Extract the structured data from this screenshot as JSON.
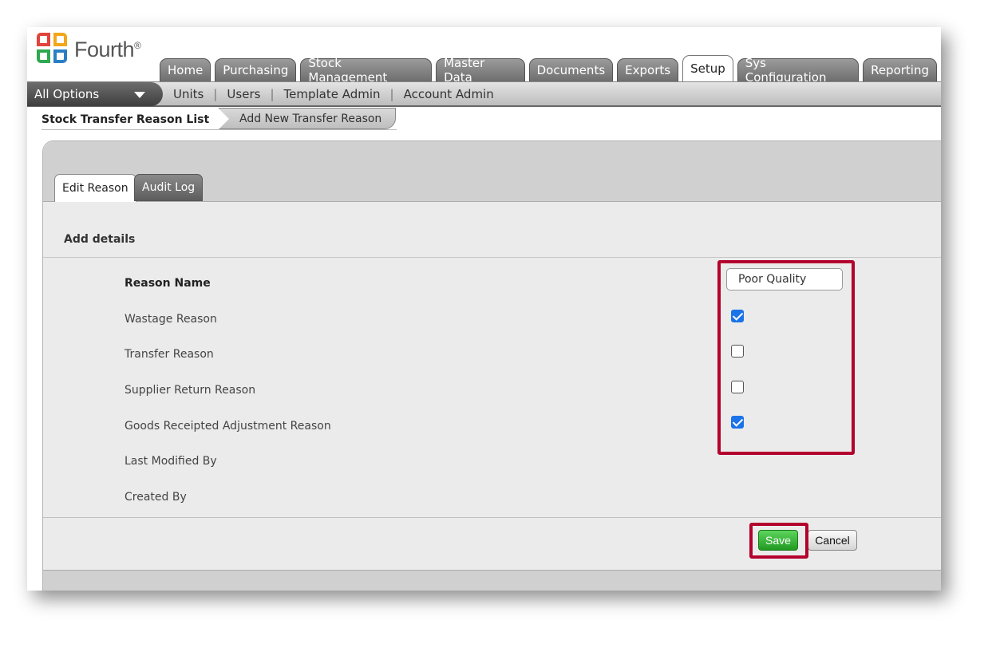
{
  "brand": {
    "name": "Fourth",
    "mark": "®"
  },
  "main_tabs": [
    {
      "label": "Home"
    },
    {
      "label": "Purchasing"
    },
    {
      "label": "Stock Management"
    },
    {
      "label": "Master Data"
    },
    {
      "label": "Documents"
    },
    {
      "label": "Exports"
    },
    {
      "label": "Setup",
      "active": true
    },
    {
      "label": "Sys Configuration"
    },
    {
      "label": "Reporting"
    }
  ],
  "subnav": {
    "dropdown_label": "All Options",
    "links": [
      "Units",
      "Users",
      "Template Admin",
      "Account Admin"
    ]
  },
  "breadcrumb": {
    "first": "Stock Transfer Reason List",
    "second": "Add New Transfer Reason"
  },
  "panel_tabs": {
    "edit": "Edit Reason",
    "audit": "Audit Log"
  },
  "form": {
    "section_title": "Add details",
    "reason_name_label": "Reason Name",
    "reason_name_value": "Poor Quality",
    "wastage_label": "Wastage Reason",
    "wastage_checked": true,
    "transfer_label": "Transfer Reason",
    "transfer_checked": false,
    "supplier_return_label": "Supplier Return Reason",
    "supplier_return_checked": false,
    "goods_receipted_label": "Goods Receipted Adjustment Reason",
    "goods_receipted_checked": true,
    "last_modified_label": "Last Modified By",
    "created_by_label": "Created By"
  },
  "actions": {
    "save": "Save",
    "cancel": "Cancel"
  },
  "colors": {
    "highlight": "#b3002d",
    "save_green": "#2aa52a",
    "checkbox_blue": "#1a73e8"
  }
}
